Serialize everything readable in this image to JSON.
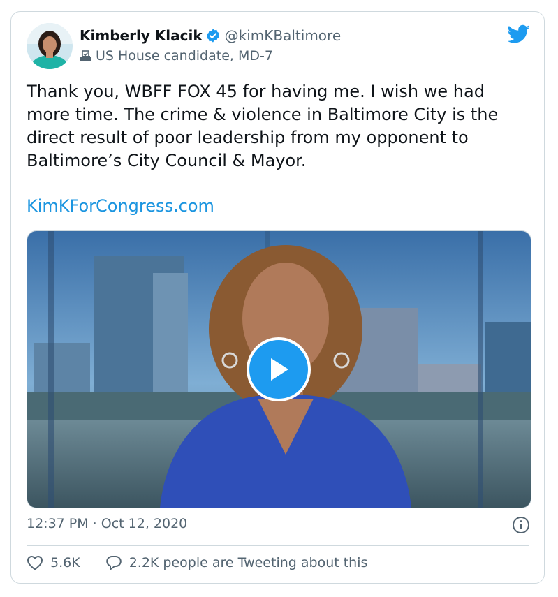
{
  "author": {
    "display_name": "Kimberly Klacik",
    "handle": "@kimKBaltimore",
    "subtitle": "US House candidate, MD-7",
    "verified": true
  },
  "tweet": {
    "text": "Thank you, WBFF FOX 45 for having me. I wish we had more time. The crime & violence in Baltimore City is the direct result of poor leadership from my opponent to Baltimore’s City Council & Mayor.",
    "link_text": "KimKForCongress.com",
    "timestamp": "12:37 PM · Oct 12, 2020"
  },
  "actions": {
    "like_count": "5.6K",
    "reply_text": "2.2K people are Tweeting about this"
  },
  "icons": {
    "verified": "verified-badge-icon",
    "ballot": "ballot-box-icon",
    "logo": "twitter-bird-icon",
    "play": "play-icon",
    "info": "info-icon",
    "like": "heart-icon",
    "reply": "speech-bubble-icon"
  },
  "colors": {
    "accent": "#1d9bf0",
    "link": "#1b95e0",
    "text": "#0f1419",
    "secondary": "#536471",
    "border": "#cfd9de"
  }
}
